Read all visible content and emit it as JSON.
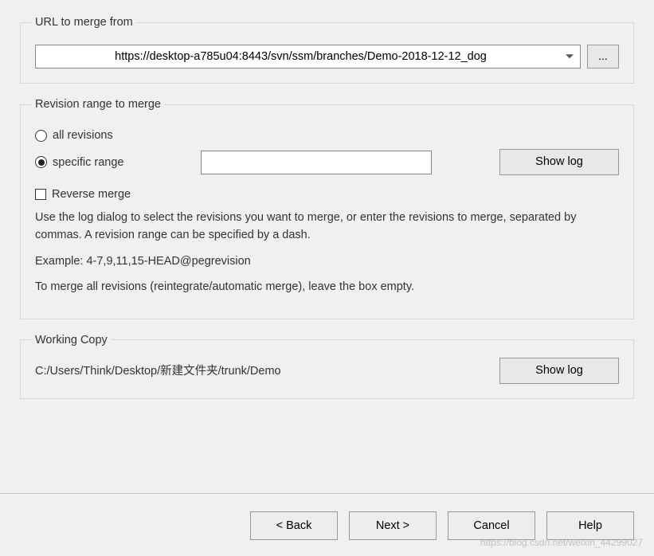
{
  "url_section": {
    "legend": "URL to merge from",
    "value": "https://desktop-a785u04:8443/svn/ssm/branches/Demo-2018-12-12_dog",
    "browse_label": "..."
  },
  "revision_section": {
    "legend": "Revision range to merge",
    "all_revisions_label": "all revisions",
    "specific_range_label": "specific range",
    "range_value": "",
    "show_log_label": "Show log",
    "reverse_merge_label": "Reverse merge",
    "help_text_1": "Use the log dialog to select the revisions you want to merge, or enter the revisions to merge, separated by commas. A revision range can be specified by a dash.",
    "help_text_2": "Example: 4-7,9,11,15-HEAD@pegrevision",
    "help_text_3": "To merge all revisions (reintegrate/automatic merge), leave the box empty."
  },
  "working_copy_section": {
    "legend": "Working Copy",
    "path": "C:/Users/Think/Desktop/新建文件夹/trunk/Demo",
    "show_log_label": "Show log"
  },
  "buttons": {
    "back": "< Back",
    "next": "Next >",
    "cancel": "Cancel",
    "help": "Help"
  },
  "watermark": "https://blog.csdn.net/weixin_44299027"
}
